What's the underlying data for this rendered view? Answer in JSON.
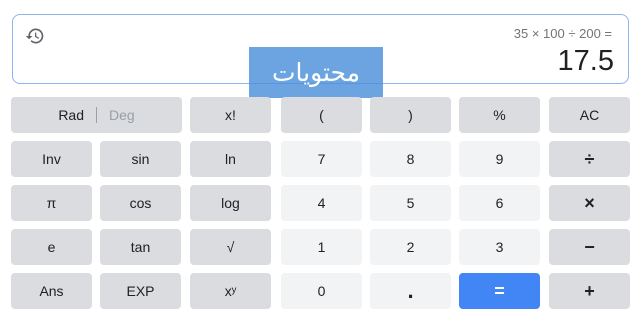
{
  "display": {
    "history_icon": "history-icon",
    "expression": "35 × 100 ÷ 200 =",
    "result": "17.5"
  },
  "watermark": {
    "text": "محتويات"
  },
  "keys": {
    "rad": "Rad",
    "deg": "Deg",
    "factorial": "x!",
    "open_paren": "(",
    "close_paren": ")",
    "percent": "%",
    "clear": "AC",
    "inv": "Inv",
    "sin": "sin",
    "ln": "ln",
    "seven": "7",
    "eight": "8",
    "nine": "9",
    "divide": "÷",
    "pi": "π",
    "cos": "cos",
    "log": "log",
    "four": "4",
    "five": "5",
    "six": "6",
    "multiply": "×",
    "e": "e",
    "tan": "tan",
    "sqrt": "√",
    "one": "1",
    "two": "2",
    "three": "3",
    "minus": "−",
    "ans": "Ans",
    "exp": "EXP",
    "power": "xʸ",
    "zero": "0",
    "decimal": ".",
    "equals": "=",
    "plus": "+"
  },
  "colors": {
    "key_light": "#f1f3f4",
    "key_dark": "#dadce0",
    "accent": "#4285f4",
    "display_border": "#8fb3ea"
  }
}
